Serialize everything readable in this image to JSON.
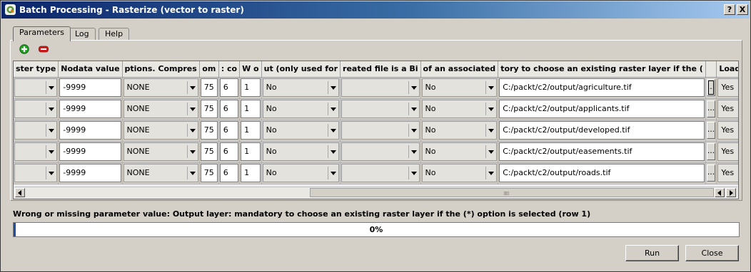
{
  "window": {
    "title": "Batch Processing - Rasterize (vector to raster)",
    "help_button": "?",
    "close_button": "X"
  },
  "tabs": [
    {
      "label": "Parameters",
      "active": true
    },
    {
      "label": "Log",
      "active": false
    },
    {
      "label": "Help",
      "active": false
    }
  ],
  "toolbar": {
    "add_icon": "plus-icon",
    "remove_icon": "minus-icon",
    "add_color": "#1e9e1e",
    "remove_color": "#d41a1a"
  },
  "grid": {
    "headers": [
      "ster type",
      "Nodata value",
      "ptions. Compres",
      "om",
      ": co",
      "W o",
      "ut (only used for",
      "reated file is a Bi",
      "of an associated",
      "tory to choose an existing raster layer if the (",
      "",
      "Load in QGIS"
    ],
    "rows": [
      {
        "raster_type": "",
        "nodata": "-9999",
        "compress": "NONE",
        "c4": "75",
        "c5": "6",
        "c6": "1",
        "c7": "No",
        "c8": "",
        "c9": "No",
        "output": "C:/packt/c2/output/agriculture.tif",
        "browse": "...",
        "load": "Yes"
      },
      {
        "raster_type": "",
        "nodata": "-9999",
        "compress": "NONE",
        "c4": "75",
        "c5": "6",
        "c6": "1",
        "c7": "No",
        "c8": "",
        "c9": "No",
        "output": "C:/packt/c2/output/applicants.tif",
        "browse": "...",
        "load": "Yes"
      },
      {
        "raster_type": "",
        "nodata": "-9999",
        "compress": "NONE",
        "c4": "75",
        "c5": "6",
        "c6": "1",
        "c7": "No",
        "c8": "",
        "c9": "No",
        "output": "C:/packt/c2/output/developed.tif",
        "browse": "...",
        "load": "Yes"
      },
      {
        "raster_type": "",
        "nodata": "-9999",
        "compress": "NONE",
        "c4": "75",
        "c5": "6",
        "c6": "1",
        "c7": "No",
        "c8": "",
        "c9": "No",
        "output": "C:/packt/c2/output/easements.tif",
        "browse": "...",
        "load": "Yes"
      },
      {
        "raster_type": "",
        "nodata": "-9999",
        "compress": "NONE",
        "c4": "75",
        "c5": "6",
        "c6": "1",
        "c7": "No",
        "c8": "",
        "c9": "No",
        "output": "C:/packt/c2/output/roads.tif",
        "browse": "...",
        "load": "Yes"
      }
    ]
  },
  "status": {
    "message": "Wrong or missing parameter value: Output layer: mandatory to choose an existing raster layer if the (*) option is selected (row 1)"
  },
  "progress": {
    "value": 0,
    "label": "0%"
  },
  "buttons": {
    "run": "Run",
    "close": "Close"
  }
}
